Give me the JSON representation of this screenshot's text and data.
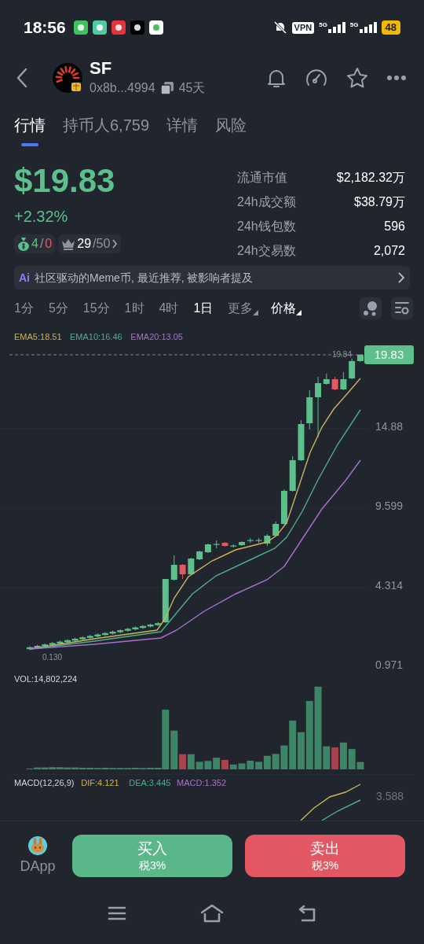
{
  "status_bar": {
    "time": "18:56",
    "vpn": "VPN",
    "network_1": "5G",
    "network_2": "5G",
    "battery": "48"
  },
  "header": {
    "symbol": "SF",
    "address": "0x8b...4994",
    "age": "45天"
  },
  "tabs": [
    {
      "label": "行情",
      "selected": true
    },
    {
      "label": "持币人6,759",
      "selected": false
    },
    {
      "label": "详情",
      "selected": false
    },
    {
      "label": "风险",
      "selected": false
    }
  ],
  "price": {
    "value": "$19.83",
    "change": "+2.32%"
  },
  "badges": [
    {
      "kind": "smart_money",
      "first": "4",
      "separator": "/",
      "second": "0"
    },
    {
      "kind": "top",
      "first": "29",
      "separator": "/50"
    }
  ],
  "stats": [
    {
      "label": "流通市值",
      "value": "$2,182.32万"
    },
    {
      "label": "24h成交额",
      "value": "$38.79万"
    },
    {
      "label": "24h钱包数",
      "value": "596"
    },
    {
      "label": "24h交易数",
      "value": "2,072"
    }
  ],
  "ai_summary": {
    "badge": "Ai",
    "text": "社区驱动的Meme币, 最近推荐, 被影响者提及"
  },
  "intervals": [
    {
      "label": "1分",
      "selected": false
    },
    {
      "label": "5分",
      "selected": false
    },
    {
      "label": "15分",
      "selected": false
    },
    {
      "label": "1时",
      "selected": false
    },
    {
      "label": "4时",
      "selected": false
    },
    {
      "label": "1日",
      "selected": true
    }
  ],
  "dropdowns": [
    {
      "label": "更多",
      "active": false
    },
    {
      "label": "价格",
      "active": true
    }
  ],
  "chart": {
    "legend": [
      {
        "text": "EMA5:18.51",
        "color": "#c8b45a"
      },
      {
        "text": "EMA10:16.46",
        "color": "#4fae8c"
      },
      {
        "text": "EMA20:13.05",
        "color": "#a673c9"
      }
    ],
    "last_price": "19.83",
    "high_label": "19.84",
    "low_label": "0.130",
    "y_labels": [
      "14.88",
      "9.599",
      "4.314",
      "0.971"
    ]
  },
  "volume": {
    "label": "VOL:14,802,224"
  },
  "macd": {
    "legend": [
      {
        "text": "MACD(12,26,9)",
        "color": "#d4d7de"
      },
      {
        "text": "DIF:4.121",
        "color": "#c8b45a"
      },
      {
        "text": "DEA:3.445",
        "color": "#4fae8c"
      },
      {
        "text": "MACD:1.352",
        "color": "#a673c9"
      }
    ],
    "y_label": "3.588"
  },
  "bottom_bar": {
    "dapp": "DApp",
    "buttons": [
      {
        "kind": "buy",
        "label": "买入",
        "tax": "税3%"
      },
      {
        "kind": "sell",
        "label": "卖出",
        "tax": "税3%"
      }
    ]
  }
}
